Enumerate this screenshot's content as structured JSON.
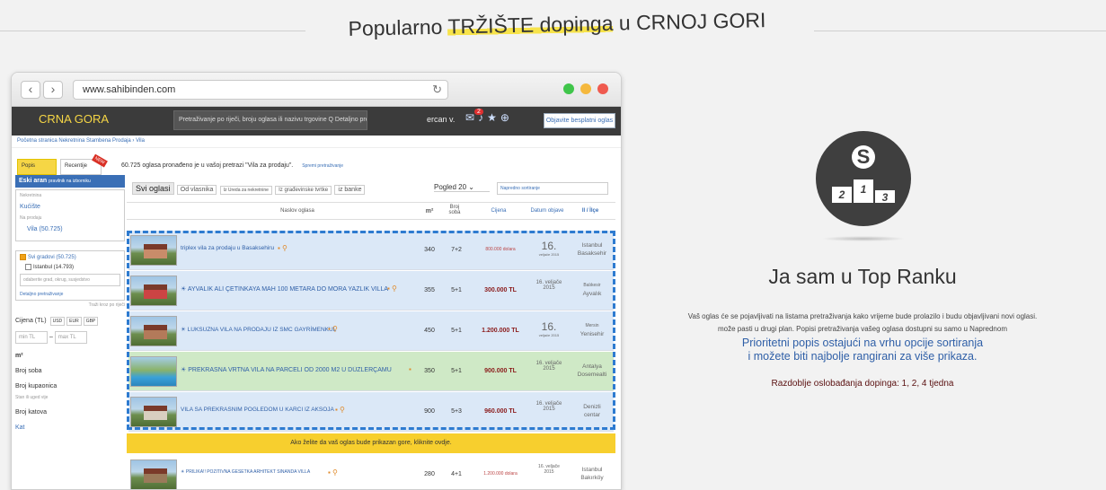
{
  "headline": {
    "before": "Popularno ",
    "highlight": "TRŽIŠTE dopinga",
    "after": " u CRNOJ GORI"
  },
  "browser": {
    "url": "www.sahibinden.com",
    "dots": [
      "#3fc54a",
      "#f5b83d",
      "#ef5a4f"
    ]
  },
  "site": {
    "logo": "CRNA GORA",
    "search_placeholder": "Pretraživanje po riječi, broju oglasa ili nazivu trgovine Q Detaljno pretraživanje",
    "user": "ercan v.",
    "notification_count": "2",
    "post_button": "Objavite besplatni oglas",
    "breadcrumb": "Početna stranica Nekretnina Stambena Prodaja  ›  Vila"
  },
  "sidebar": {
    "tab_list": "Popis",
    "tab_recent": "Recentije",
    "new_tag": "NEW",
    "blue_bar": "Eski aran",
    "blue_bar_hint": "pravilnik na izborniku",
    "category_hint": "Nekretnina",
    "houses": "Kućište",
    "for_sale": "Na prodaju",
    "villa": "Vila (50.725)",
    "all_cities": "Svi gradovi (50.725)",
    "istanbul": "Istanbul (14.793)",
    "city_input": "odaberite grad, okrug, susjedstvo",
    "details": "Detaljno pretraživanje",
    "close_note": "Traži kroz po riječi",
    "price_label": "Cijena (TL)",
    "currencies": [
      "USD",
      "EUR",
      "GBP"
    ],
    "min": "min TL",
    "max": "max TL",
    "area": "m²",
    "rooms": "Broj soba",
    "bathrooms": "Broj kupaonica",
    "floor_hint": "Stan ili uged vije",
    "floors": "Broj katova",
    "kat": "Kat"
  },
  "results": {
    "count_text": "60.725 oglasa pronađeno je u vašoj pretrazi \"Vila za prodaju\".",
    "save_search": "Spremi pretraživanje",
    "tabs": [
      "Svi oglasi",
      "Od vlasnika",
      "Iz Ureda za nekretnine",
      "Iz građevinske tvrtke",
      "iz banke"
    ],
    "view": "Pogled 20",
    "sort": "Napredno sortiranje",
    "headers": {
      "title": "Naslov oglasa",
      "m2": "m²",
      "rooms": "Broj soba",
      "price": "Cijena",
      "date": "Datum objave",
      "location": "Il / İlçe"
    },
    "rows": [
      {
        "title": "triplex vila za prodaju u Basaksehiru",
        "m2": "340",
        "rooms": "7+2",
        "price": "800.000 dolara",
        "date_day": "16.",
        "date_rest": "veljače 2015",
        "city": "Istanbul",
        "district": "Basaksehir"
      },
      {
        "title": "AYVALIK ALİ ÇETİNKAYA MAH 100 METARA DO MORA YAZLIK VILLA",
        "m2": "355",
        "rooms": "5+1",
        "price": "300.000 TL",
        "date_day": "16. veljače",
        "date_rest": "2015",
        "city": "Balıkesir",
        "district": "Ayvalık"
      },
      {
        "title": "LUKSUZNA VILA NA PRODAJU IZ SMC GAYRİMENKUL",
        "m2": "450",
        "rooms": "5+1",
        "price": "1.200.000 TL",
        "date_day": "16.",
        "date_rest": "veljače 2015",
        "city": "Mersin",
        "district": "Yenisehir"
      },
      {
        "title": "PREKRASNA VRTNA VILA NA PARCELI OD 2000 M2 U DÜZLERÇAMU",
        "m2": "350",
        "rooms": "5+1",
        "price": "900.000 TL",
        "date_day": "16. veljače",
        "date_rest": "2015",
        "city": "Antalya",
        "district": "Dosemealti"
      },
      {
        "title": "VILA SA PREKRASNIM POGLEDOM U KARCI IZ AKSOJA",
        "m2": "900",
        "rooms": "5+3",
        "price": "960.000 TL",
        "date_day": "16. veljače",
        "date_rest": "2015",
        "city": "Denizli",
        "district": "centar"
      },
      {
        "title": "PRILIKA!! POZITIVNA GESETKA ARHITEKT SINANDA VILLA",
        "m2": "280",
        "rooms": "4+1",
        "price": "1.200.000 dolara",
        "date_day": "16. veljače",
        "date_rest": "2015",
        "city": "Istanbul",
        "district": "Bakırköy"
      }
    ],
    "promo": "Ako želite da vaš oglas bude prikazan gore, kliknite ovdje."
  },
  "feature": {
    "badge_letter": "S",
    "podium": [
      "2",
      "1",
      "3"
    ],
    "title": "Ja sam u Top Ranku",
    "body_line1": "Vaš oglas će se pojavljivati na listama pretraživanja kako vrijeme bude prolazilo i budu objavljivani novi oglasi.",
    "body_line2": "može pasti u drugi plan. Popisi pretraživanja vašeg oglasa dostupni su samo u Naprednom",
    "strong_line1": "Prioritetni popis ostajući na vrhu opcije sortiranja",
    "strong_line2": "i možete biti najbolje rangirani za više prikaza.",
    "period": "Razdoblje oslobađanja dopinga: 1, 2, 4 tjedna"
  }
}
